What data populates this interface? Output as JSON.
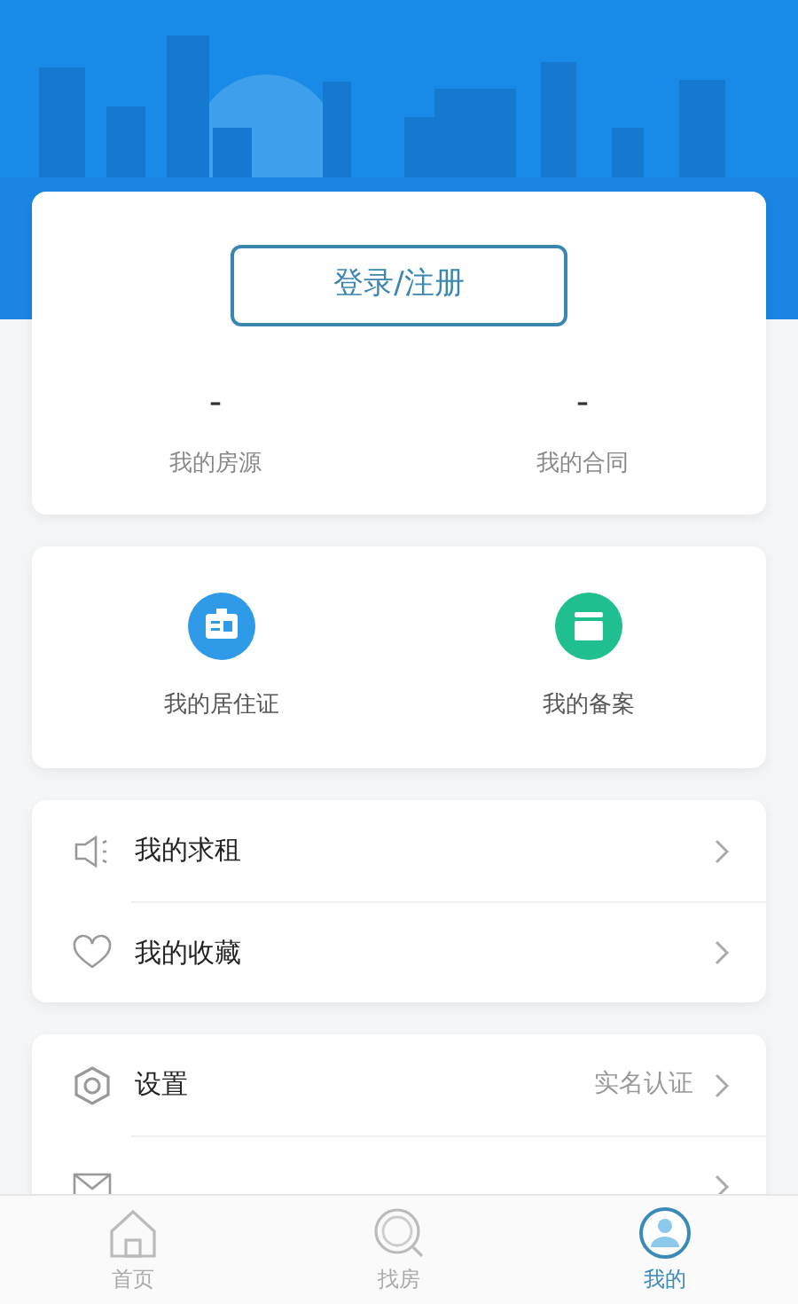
{
  "login_button": "登录/注册",
  "stats": [
    {
      "value": "-",
      "label": "我的房源"
    },
    {
      "value": "-",
      "label": "我的合同"
    }
  ],
  "shortcuts": [
    {
      "kind": "id-card",
      "label": "我的居住证",
      "color": "#2f9ae8"
    },
    {
      "kind": "archive",
      "label": "我的备案",
      "color": "#1fbf8f"
    }
  ],
  "menu_groups": [
    [
      {
        "kind": "speaker",
        "label": "我的求租"
      },
      {
        "kind": "heart",
        "label": "我的收藏"
      }
    ],
    [
      {
        "kind": "gear",
        "label": "设置",
        "note": "实名认证"
      },
      {
        "kind": "mail"
      }
    ]
  ],
  "tabs": [
    {
      "kind": "home",
      "label": "首页",
      "selected": false
    },
    {
      "kind": "search",
      "label": "找房",
      "selected": false
    },
    {
      "kind": "user",
      "label": "我的",
      "selected": true
    }
  ]
}
